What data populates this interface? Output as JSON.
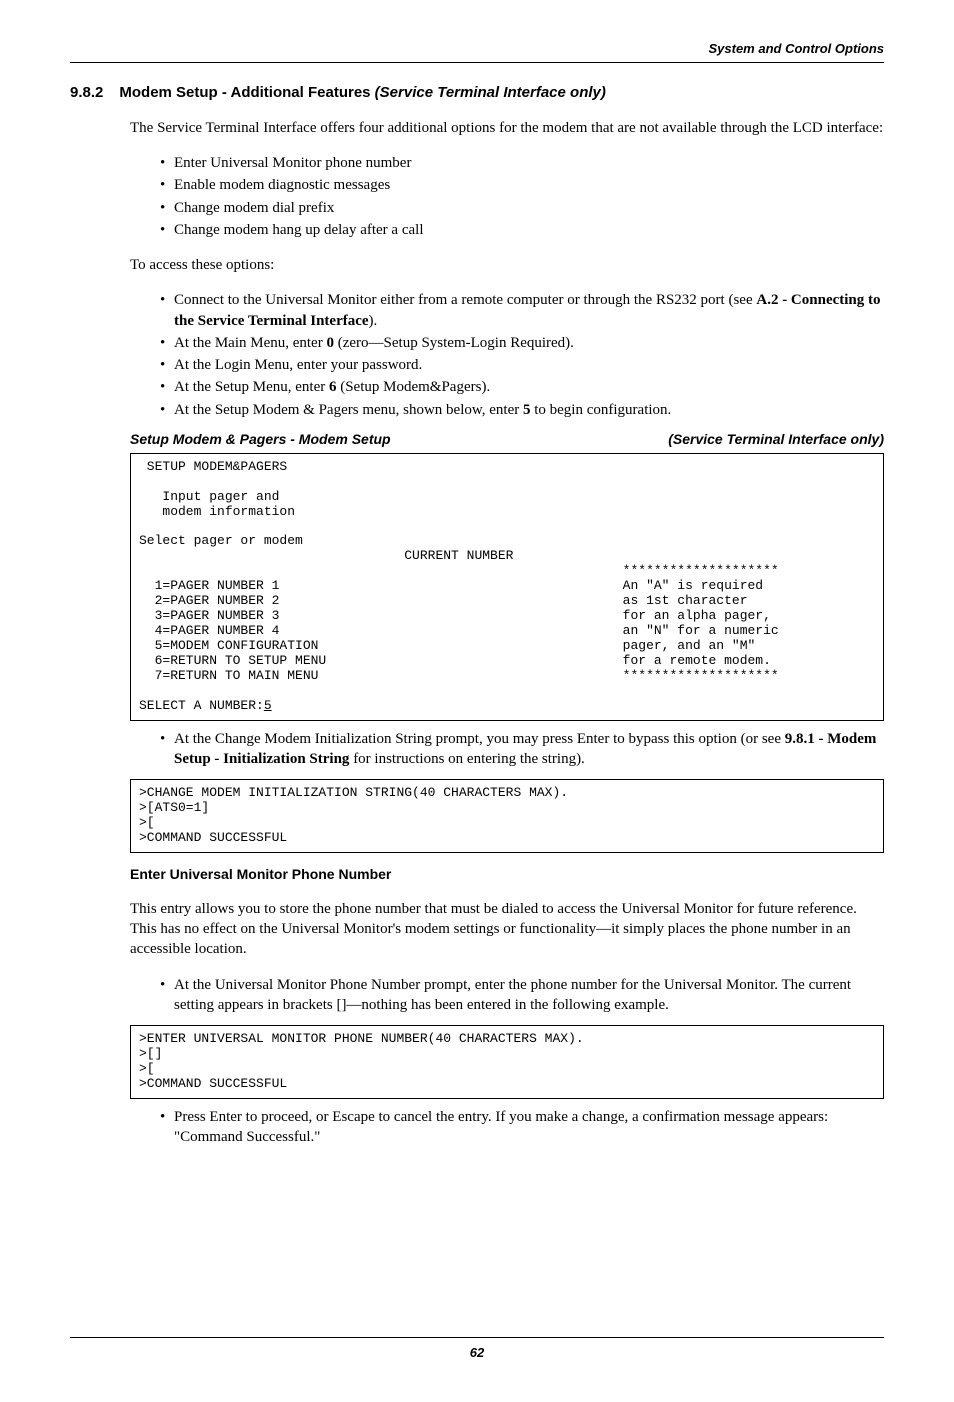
{
  "header": {
    "right": "System and Control Options"
  },
  "section": {
    "number": "9.8.2",
    "title_plain": "Modem Setup - Additional Features ",
    "title_ital": "(Service Terminal Interface only)"
  },
  "intro": "The Service Terminal Interface offers four additional options for the modem that are not available through the LCD interface:",
  "bullets1": [
    "Enter Universal Monitor phone number",
    "Enable modem diagnostic messages",
    "Change modem dial prefix",
    "Change modem hang up delay after a call"
  ],
  "access_lead": "To access these options:",
  "bullets2_html": [
    "Connect to the Universal Monitor either from a remote computer or through the RS232 port (see <b>A.2 - Connecting to the Service Terminal Interface</b>).",
    "At the Main Menu, enter <b>0</b> (zero—Setup System-Login Required).",
    "At the Login Menu, enter your password.",
    "At the Setup Menu, enter <b>6</b> (Setup Modem&Pagers).",
    "At the Setup Modem & Pagers menu, shown below, enter <b>5</b> to begin configuration."
  ],
  "subhead1": {
    "left": "Setup Modem & Pagers - Modem Setup",
    "right": "(Service Terminal Interface only)"
  },
  "terminal1": " SETUP MODEM&PAGERS\n\n   Input pager and\n   modem information\n\nSelect pager or modem\n                                  CURRENT NUMBER\n                                                              ********************\n  1=PAGER NUMBER 1                                            An \"A\" is required\n  2=PAGER NUMBER 2                                            as 1st character\n  3=PAGER NUMBER 3                                            for an alpha pager,\n  4=PAGER NUMBER 4                                            an \"N\" for a numeric\n  5=MODEM CONFIGURATION                                       pager, and an \"M\"\n  6=RETURN TO SETUP MENU                                      for a remote modem.\n  7=RETURN TO MAIN MENU                                       ********************\n\nSELECT A NUMBER:",
  "terminal1_input": "5",
  "after_t1_html": "At the Change Modem Initialization String prompt, you may press Enter to bypass this option (or see <b>9.8.1 - Modem Setup - Initialization String</b> for instructions on entering the string).",
  "terminal2": ">CHANGE MODEM INITIALIZATION STRING(40 CHARACTERS MAX).\n>[ATS0=1]\n>[\n>COMMAND SUCCESSFUL",
  "runhead": "Enter Universal Monitor Phone Number",
  "para_phone": "This entry allows you to store the phone number that must be dialed to access the Universal Monitor for future reference. This has no effect on the Universal Monitor's modem settings or functionality—it simply places the phone number in an accessible location.",
  "bullet_phone": "At the Universal Monitor Phone Number prompt, enter the phone number for the Universal Monitor. The current setting appears in brackets []—nothing has been entered in the following example.",
  "terminal3": ">ENTER UNIVERSAL MONITOR PHONE NUMBER(40 CHARACTERS MAX).\n>[]\n>[\n>COMMAND SUCCESSFUL",
  "bullet_confirm": "Press Enter to proceed, or Escape to cancel the entry. If you make a change, a confirmation message appears: \"Command Successful.\"",
  "page_number": "62"
}
